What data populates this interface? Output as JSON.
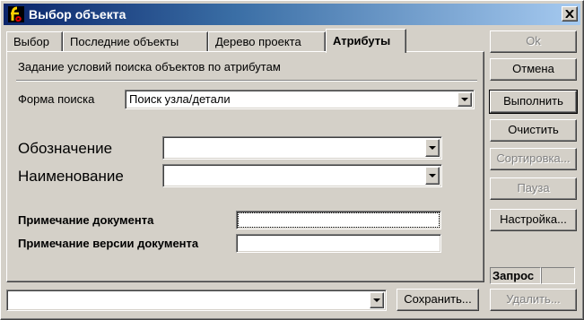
{
  "window": {
    "title": "Выбор объекта",
    "icon": "application-logo-icon",
    "close_icon": "close-icon"
  },
  "tabs": [
    {
      "label": "Выбор",
      "active": false
    },
    {
      "label": "Последние объекты",
      "active": false
    },
    {
      "label": "Дерево проекта",
      "active": false
    },
    {
      "label": "Атрибуты",
      "active": true
    }
  ],
  "panel": {
    "header": "Задание условий поиска объектов по атрибутам",
    "search_form": {
      "label": "Форма поиска",
      "value": "Поиск узла/детали"
    },
    "designation": {
      "label": "Обозначение",
      "value": ""
    },
    "name": {
      "label": "Наименование",
      "value": ""
    },
    "doc_note": {
      "label": "Примечание документа",
      "value": ""
    },
    "doc_version_note": {
      "label": "Примечание версии документа",
      "value": ""
    }
  },
  "buttons": {
    "ok": "Ok",
    "cancel": "Отмена",
    "execute": "Выполнить",
    "clear": "Очистить",
    "sort": "Сортировка...",
    "pause": "Пауза",
    "settings": "Настройка..."
  },
  "status": {
    "query_label": "Запрос",
    "query_value": ""
  },
  "bottom": {
    "saved_query_value": "",
    "save_button": "Сохранить...",
    "delete_button": "Удалить..."
  },
  "colors": {
    "title_bar_start": "#0a246a",
    "title_bar_end": "#a6caf0",
    "face": "#d4d0c8"
  }
}
